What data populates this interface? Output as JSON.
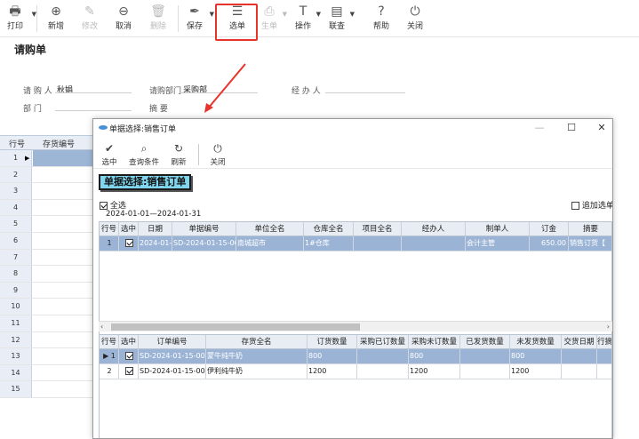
{
  "toolbar": {
    "print": "打印",
    "new": "新增",
    "edit": "修改",
    "cancel": "取消",
    "delete": "删除",
    "save": "保存",
    "select_order": "选单",
    "generate_order": "生单",
    "operate": "操作",
    "link_query": "联查",
    "help": "帮助",
    "close": "关闭"
  },
  "form": {
    "title": "请购单",
    "requester_label": "请 购 人",
    "requester_value": "秋娟",
    "dept_label": "请购部门",
    "dept_value": "采购部",
    "handler_label": "经 办 人",
    "department_label": "部    门",
    "summary_label": "摘    要"
  },
  "bg_grid": {
    "col_row": "行号",
    "col_item_code": "存货编号",
    "rows": [
      "1",
      "2",
      "3",
      "4",
      "5",
      "6",
      "7",
      "8",
      "9",
      "10",
      "11",
      "12",
      "13",
      "14",
      "15"
    ]
  },
  "dialog": {
    "window_title": "单据选择:销售订单",
    "toolbar": {
      "select": "选中",
      "query": "查询条件",
      "refresh": "刷新",
      "close": "关闭"
    },
    "heading": "单据选择:销售订单",
    "select_all": "全选",
    "date_range": "2024-01-01—2024-01-31",
    "append_select": "追加选单",
    "top_table": {
      "headers": [
        "行号",
        "选中",
        "日期",
        "单据编号",
        "单位全名",
        "仓库全名",
        "项目全名",
        "经办人",
        "制单人",
        "订金",
        "摘要"
      ],
      "rows": [
        {
          "row": "1",
          "checked": true,
          "date": "2024-01-",
          "doc_no": "SD-2024-01-15-00",
          "unit": "南城超市",
          "warehouse": "1#仓库",
          "project": "",
          "handler": "",
          "creator": "会计主管",
          "deposit": "650.00",
          "summary": "销售订货【"
        }
      ]
    },
    "bottom_table": {
      "headers": [
        "行号",
        "选中",
        "订单编号",
        "存货全名",
        "订货数量",
        "采购已订数量",
        "采购未订数量",
        "已发货数量",
        "未发货数量",
        "交货日期",
        "行摘"
      ],
      "rows": [
        {
          "row": "1",
          "checked": true,
          "order_no": "SD-2024-01-15-00",
          "item": "蒙牛纯牛奶",
          "qty": "800",
          "ordered": "",
          "unordered": "800",
          "shipped": "",
          "unshipped": "800"
        },
        {
          "row": "2",
          "checked": true,
          "order_no": "SD-2024-01-15-00",
          "item": "伊利纯牛奶",
          "qty": "1200",
          "ordered": "",
          "unordered": "1200",
          "shipped": "",
          "unshipped": "1200"
        }
      ]
    }
  },
  "colors": {
    "highlight": "#e8332b",
    "selection": "#9bb4d6",
    "heading_bg": "#7fd6ee"
  }
}
